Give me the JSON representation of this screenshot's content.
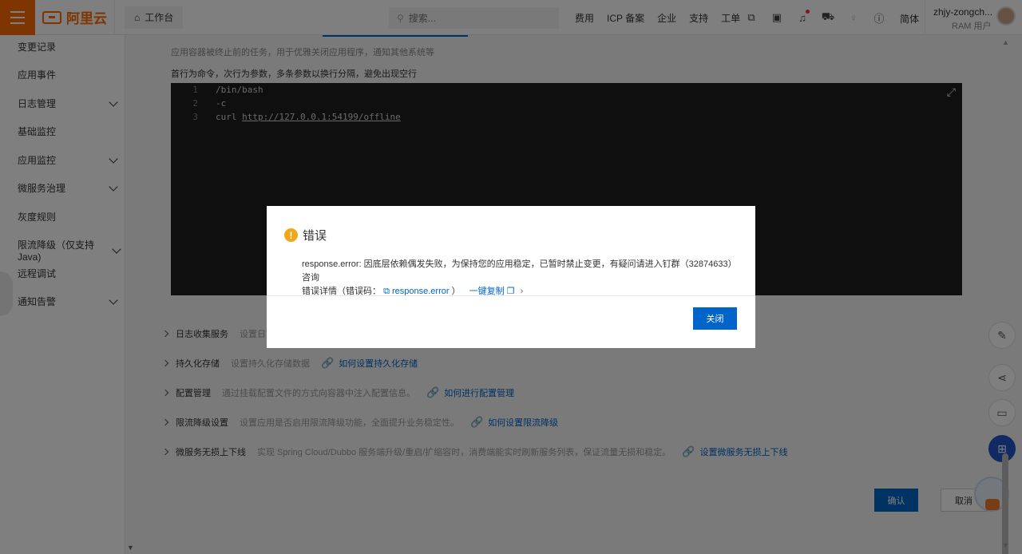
{
  "topbar": {
    "logo_text": "阿里云",
    "workbench": "工作台",
    "search_placeholder": "搜索...",
    "links": [
      "费用",
      "ICP 备案",
      "企业",
      "支持",
      "工单"
    ],
    "lang": "简体",
    "user_name": "zhjy-zongch...",
    "user_role": "RAM 用户"
  },
  "sidebar": {
    "items": [
      {
        "label": "变更记录",
        "expandable": false
      },
      {
        "label": "应用事件",
        "expandable": false
      },
      {
        "label": "日志管理",
        "expandable": true
      },
      {
        "label": "基础监控",
        "expandable": false
      },
      {
        "label": "应用监控",
        "expandable": true
      },
      {
        "label": "微服务治理",
        "expandable": true
      },
      {
        "label": "灰度规则",
        "expandable": false
      },
      {
        "label": "限流降级（仅支持Java)",
        "expandable": true
      },
      {
        "label": "远程调试",
        "expandable": false
      },
      {
        "label": "通知告警",
        "expandable": true
      }
    ]
  },
  "main": {
    "hint": "应用容器被终止前的任务，用于优雅关闭应用程序，通知其他系统等",
    "cmd_label": "首行为命令，次行为参数，多条参数以换行分隔，避免出现空行",
    "editor_lines": [
      {
        "num": "1",
        "code": "/bin/bash"
      },
      {
        "num": "2",
        "code": "-c"
      },
      {
        "num": "3",
        "prefix": "curl ",
        "url": "http://127.0.0.1:54199/offline"
      }
    ],
    "sections": [
      {
        "title": "日志收集服务",
        "desc": "设置日志",
        "link": ""
      },
      {
        "title": "持久化存储",
        "desc": "设置持久化存储数据",
        "link": "如何设置持久化存储"
      },
      {
        "title": "配置管理",
        "desc": "通过挂载配置文件的方式向容器中注入配置信息。",
        "link": "如何进行配置管理"
      },
      {
        "title": "限流降级设置",
        "desc": "设置应用是否启用限流降级功能，全面提升业务稳定性。",
        "link": "如何设置限流降级"
      },
      {
        "title": "微服务无损上下线",
        "desc": "实现 Spring Cloud/Dubbo 服务端升级/重启/扩缩容时，消费端能实时刷新服务列表，保证流量无损和稳定。",
        "link": "设置微服务无损上下线"
      }
    ],
    "confirm": "确认",
    "cancel": "取消"
  },
  "dialog": {
    "title": "错误",
    "message": "response.error: 因底层依赖偶发失败，为保持您的应用稳定，已暂时禁止变更，有疑问请进入钉群（32874633）咨询",
    "detail_prefix": "错误详情（错误码：",
    "detail_code": "response.error",
    "detail_suffix": "）",
    "copy": "一键复制",
    "close": "关闭"
  },
  "colors": {
    "brand": "#ff6a00",
    "primary": "#0064c8",
    "warning": "#f2a619"
  }
}
